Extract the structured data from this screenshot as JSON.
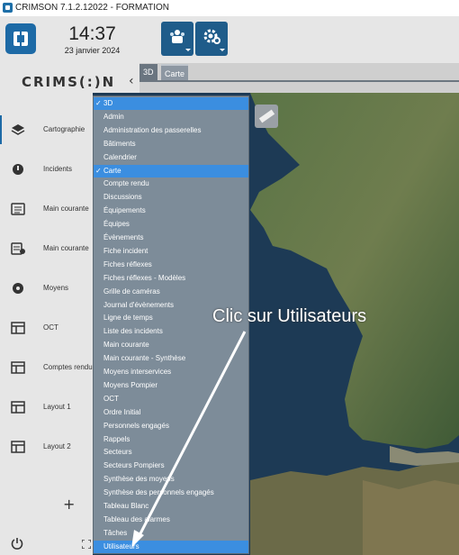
{
  "window": {
    "title": "CRIMSON 7.1.2.12022 - FORMATION"
  },
  "header": {
    "time": "14:37",
    "date": "23 janvier 2024",
    "toolbar_icons": [
      "users-icon",
      "settings-icon"
    ]
  },
  "brand": {
    "name": "CRIMS(:)N",
    "collapse_glyph": "‹"
  },
  "sidebar": {
    "items": [
      {
        "label": "Cartographie",
        "icon": "layers-icon"
      },
      {
        "label": "Incidents",
        "icon": "incidents-icon"
      },
      {
        "label": "Main courante",
        "icon": "log-icon"
      },
      {
        "label": "Main courante",
        "icon": "log-alert-icon"
      },
      {
        "label": "Moyens",
        "icon": "resources-icon"
      },
      {
        "label": "OCT",
        "icon": "layout-icon"
      },
      {
        "label": "Comptes rendu",
        "icon": "layout-icon"
      },
      {
        "label": "Layout 1",
        "icon": "layout-icon"
      },
      {
        "label": "Layout 2",
        "icon": "layout-icon"
      }
    ],
    "add_label": "+"
  },
  "tabs": [
    {
      "label": "3D"
    },
    {
      "label": "Carte"
    }
  ],
  "dropdown": {
    "items": [
      {
        "label": "3D",
        "selected": true,
        "check": "✓"
      },
      {
        "label": "Admin"
      },
      {
        "label": "Administration des passerelles"
      },
      {
        "label": "Bâtiments"
      },
      {
        "label": "Calendrier"
      },
      {
        "label": "Carte",
        "selected": true,
        "check": "✓"
      },
      {
        "label": "Compte rendu"
      },
      {
        "label": "Discussions"
      },
      {
        "label": "Équipements"
      },
      {
        "label": "Équipes"
      },
      {
        "label": "Évènements"
      },
      {
        "label": "Fiche incident"
      },
      {
        "label": "Fiches réflexes"
      },
      {
        "label": "Fiches réflexes - Modèles"
      },
      {
        "label": "Grille de caméras"
      },
      {
        "label": "Journal d'évènements"
      },
      {
        "label": "Ligne de temps"
      },
      {
        "label": "Liste des incidents"
      },
      {
        "label": "Main courante"
      },
      {
        "label": "Main courante - Synthèse"
      },
      {
        "label": "Moyens interservices"
      },
      {
        "label": "Moyens Pompier"
      },
      {
        "label": "OCT"
      },
      {
        "label": "Ordre Initial"
      },
      {
        "label": "Personnels engagés"
      },
      {
        "label": "Rappels"
      },
      {
        "label": "Secteurs"
      },
      {
        "label": "Secteurs Pompiers"
      },
      {
        "label": "Synthèse des moyens"
      },
      {
        "label": "Synthèse des personnels engagés"
      },
      {
        "label": "Tableau Blanc"
      },
      {
        "label": "Tableau des alarmes"
      },
      {
        "label": "Tâches"
      },
      {
        "label": "Utilisateurs",
        "selected": true
      }
    ]
  },
  "annotation": {
    "text": "Clic sur Utilisateurs"
  },
  "colors": {
    "accent": "#1d6aa6",
    "dropdown_bg": "#7d8c99",
    "selected": "#3b8ee0",
    "map_sea": "#1d3a55",
    "map_land": "#4e6a3e"
  }
}
